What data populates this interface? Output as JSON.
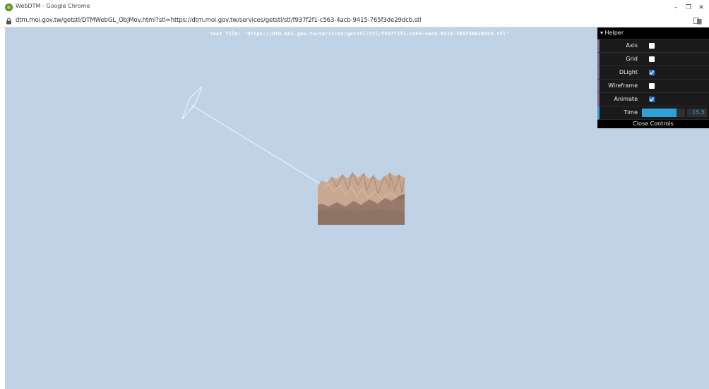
{
  "window": {
    "title": "WebDTM - Google Chrome",
    "controls": [
      "–",
      "❐",
      "✕"
    ]
  },
  "address_bar": {
    "url": "dtm.moi.gov.tw/getstl/DTMWebGL_ObjMov.html?stl=https://dtm.moi.gov.tw/services/getstl/stl/f937f2f1-c563-4acb-9415-765f3de29dcb.stl"
  },
  "viewport": {
    "background": "#c0d2e5",
    "info_text": "test file: 'https://dtm.moi.gov.tw/services/getstl/stl/f937f2f1-c563-4acb-9415-765f3de29dcb.stl'"
  },
  "gui": {
    "folder_title": "▾ Helper",
    "controls": [
      {
        "label": "Axis",
        "type": "checkbox",
        "checked": false
      },
      {
        "label": "Grid",
        "type": "checkbox",
        "checked": false
      },
      {
        "label": "DLight",
        "type": "checkbox",
        "checked": true
      },
      {
        "label": "Wireframe",
        "type": "checkbox",
        "checked": false
      },
      {
        "label": "Animate",
        "type": "checkbox",
        "checked": true
      }
    ],
    "time": {
      "label": "Time",
      "value": "15.5",
      "fill_fraction": 0.8
    },
    "close_label": "Close Controls"
  },
  "colors": {
    "terrain_top": "#c9a891",
    "terrain_side": "#8e7464",
    "slider_fill": "#2fa1d6",
    "checkbox_checked": "#2a7fd4"
  }
}
